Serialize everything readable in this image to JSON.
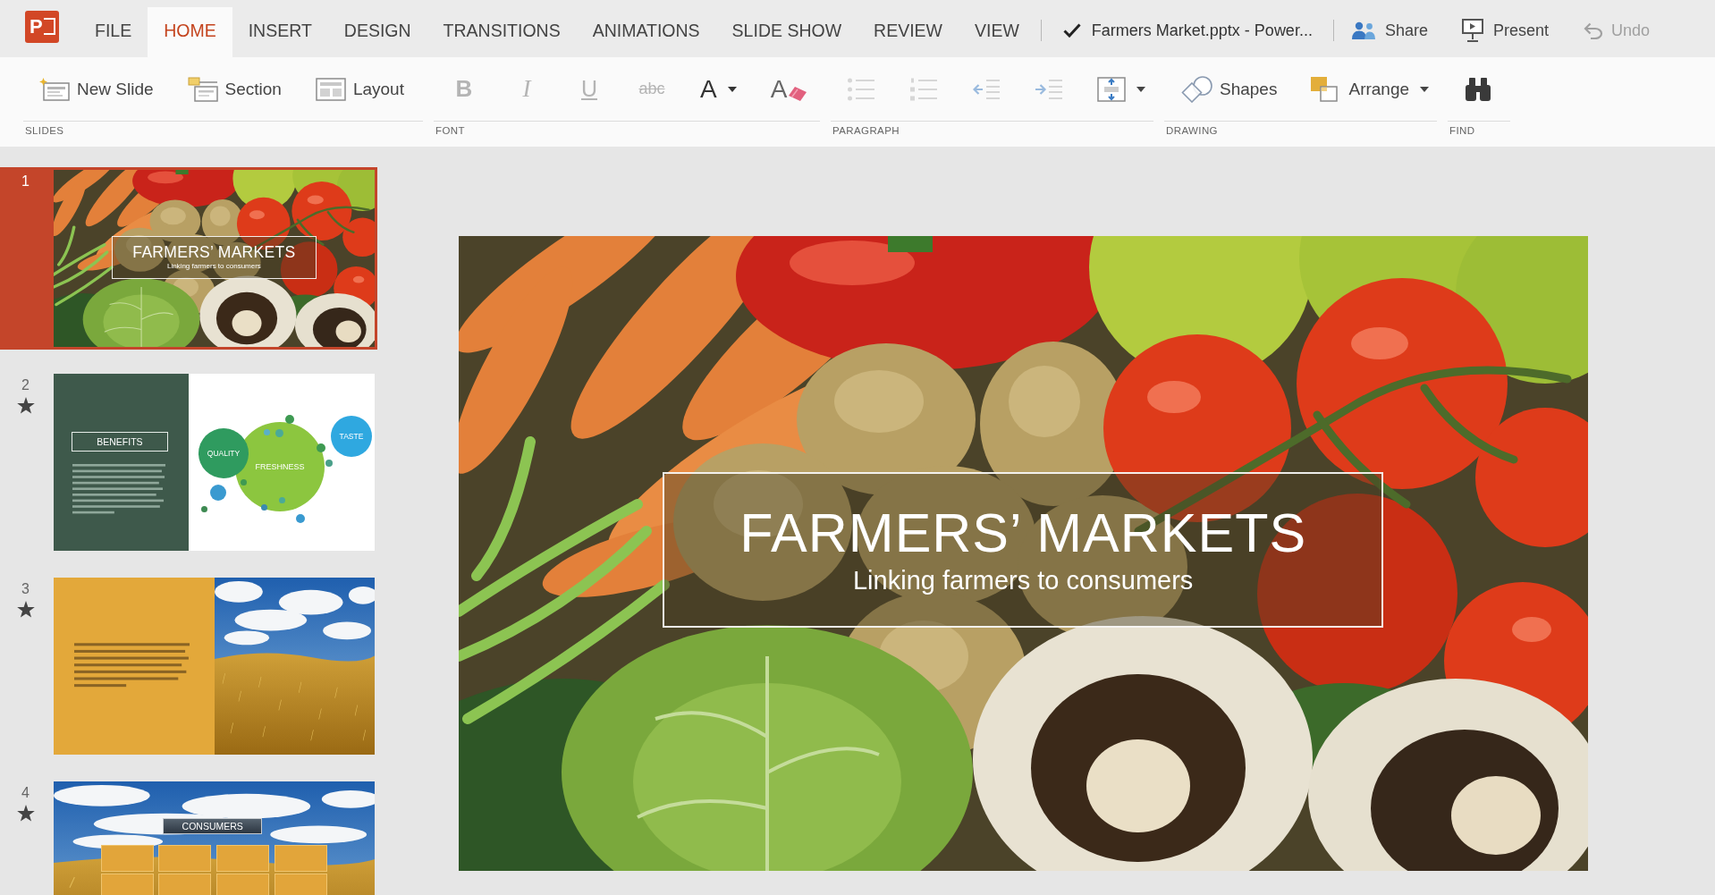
{
  "app_logo": {
    "text": "P"
  },
  "tabs": [
    {
      "label": "FILE",
      "selected": false
    },
    {
      "label": "HOME",
      "selected": true
    },
    {
      "label": "INSERT",
      "selected": false
    },
    {
      "label": "DESIGN",
      "selected": false
    },
    {
      "label": "TRANSITIONS",
      "selected": false
    },
    {
      "label": "ANIMATIONS",
      "selected": false
    },
    {
      "label": "SLIDE SHOW",
      "selected": false
    },
    {
      "label": "REVIEW",
      "selected": false
    },
    {
      "label": "VIEW",
      "selected": false
    }
  ],
  "document_title": "Farmers Market.pptx - Power...",
  "actions": [
    {
      "kind": "share",
      "label": "Share",
      "disabled": false
    },
    {
      "kind": "present",
      "label": "Present",
      "disabled": false
    },
    {
      "kind": "undo",
      "label": "Undo",
      "disabled": true
    }
  ],
  "ribbon": {
    "groups": [
      {
        "label": "SLIDES",
        "items": [
          {
            "kind": "newslide",
            "label": "New Slide",
            "disabled": false,
            "dropdown": false
          },
          {
            "kind": "section",
            "label": "Section",
            "disabled": false,
            "dropdown": false
          },
          {
            "kind": "layout",
            "label": "Layout",
            "disabled": false,
            "dropdown": false
          }
        ]
      },
      {
        "label": "FONT",
        "items": [
          {
            "kind": "bold",
            "label": "B",
            "disabled": true,
            "dropdown": false
          },
          {
            "kind": "italic",
            "label": "I",
            "disabled": true,
            "dropdown": false
          },
          {
            "kind": "underline",
            "label": "U",
            "disabled": true,
            "dropdown": false
          },
          {
            "kind": "strike",
            "label": "abc",
            "disabled": true,
            "dropdown": false
          },
          {
            "kind": "fontcolor",
            "label": "A",
            "disabled": false,
            "dropdown": true
          },
          {
            "kind": "clearformat",
            "label": "A",
            "disabled": false,
            "dropdown": false
          }
        ]
      },
      {
        "label": "PARAGRAPH",
        "items": [
          {
            "kind": "bullets",
            "disabled": true,
            "dropdown": false
          },
          {
            "kind": "numbering",
            "disabled": true,
            "dropdown": false
          },
          {
            "kind": "outdent",
            "disabled": true,
            "dropdown": false
          },
          {
            "kind": "indent",
            "disabled": true,
            "dropdown": false
          },
          {
            "kind": "textalign",
            "disabled": false,
            "dropdown": true
          }
        ]
      },
      {
        "label": "DRAWING",
        "items": [
          {
            "kind": "shapes",
            "label": "Shapes",
            "disabled": false,
            "dropdown": false
          },
          {
            "kind": "arrange",
            "label": "Arrange",
            "disabled": false,
            "dropdown": true
          }
        ]
      },
      {
        "label": "FIND",
        "items": [
          {
            "kind": "find",
            "disabled": false,
            "dropdown": false
          }
        ]
      }
    ]
  },
  "slides": [
    {
      "number": "1",
      "kind": "title",
      "selected": true,
      "animated": false,
      "title": "FARMERS’ MARKETS",
      "subtitle": "Linking farmers to consumers"
    },
    {
      "number": "2",
      "kind": "bubbles",
      "selected": false,
      "animated": true,
      "heading": "BENEFITS",
      "bubbles": [
        {
          "label": "QUALITY",
          "color": "#2f9b5f"
        },
        {
          "label": "FRESHNESS",
          "color": "#8cc63f"
        },
        {
          "label": "TASTE",
          "color": "#2fa8e0"
        }
      ]
    },
    {
      "number": "3",
      "kind": "split",
      "selected": false,
      "animated": true
    },
    {
      "number": "4",
      "kind": "diagram",
      "selected": false,
      "animated": true,
      "heading": "CONSUMERS"
    }
  ],
  "slide_editor": {
    "title": "FARMERS’ MARKETS",
    "subtitle": "Linking farmers to consumers"
  }
}
